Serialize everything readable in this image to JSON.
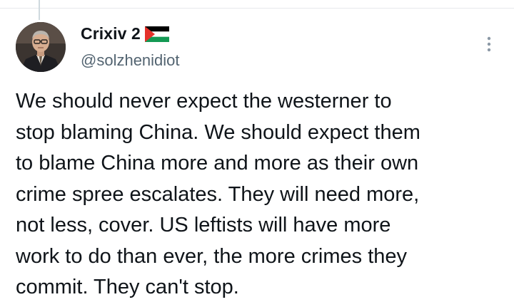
{
  "tweet": {
    "author": {
      "display_name": "Crixiv 2",
      "flag_icon": "palestine-flag-icon",
      "handle": "@solzhenidiot",
      "avatar_icon": "avatar-portrait"
    },
    "more_icon": "vertical-ellipsis-icon",
    "text": "We should never expect the westerner to\nstop blaming China. We should expect them\nto blame China more and more as their own\ncrime spree escalates. They will need more,\nnot less, cover. US leftists will have more\nwork to do than ever, the more crimes they\ncommit. They can't stop."
  },
  "colors": {
    "text_primary": "#0f1419",
    "text_secondary": "#536471",
    "flag_black": "#000000",
    "flag_green": "#149954",
    "flag_red": "#e4312b"
  }
}
